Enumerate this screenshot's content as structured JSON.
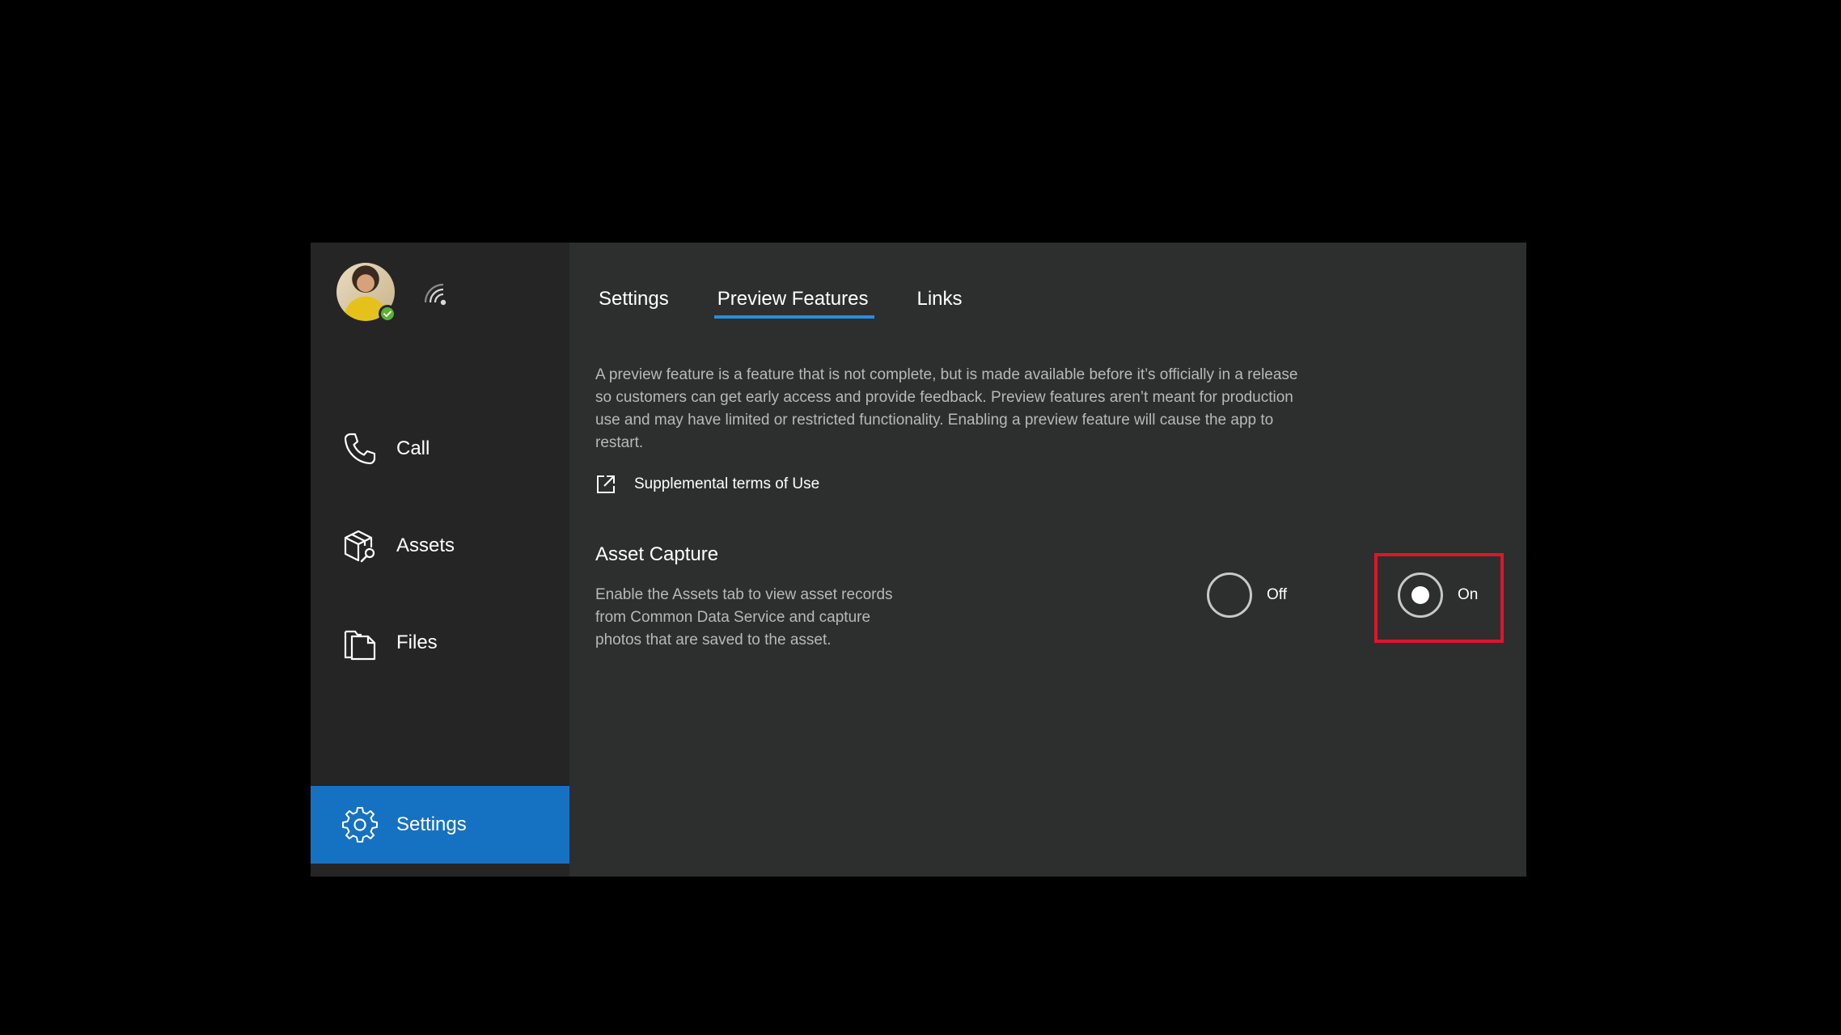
{
  "sidebar": {
    "avatar_icon": "user-avatar",
    "status_icon": "presence-available-icon",
    "signal_icon": "connection-signal-icon",
    "items": [
      {
        "label": "Call",
        "icon": "phone-icon"
      },
      {
        "label": "Assets",
        "icon": "assets-icon"
      },
      {
        "label": "Files",
        "icon": "files-icon"
      }
    ],
    "settings": {
      "label": "Settings",
      "icon": "gear-icon",
      "active": true
    }
  },
  "tabs": [
    {
      "label": "Settings"
    },
    {
      "label": "Preview Features",
      "active": true
    },
    {
      "label": "Links"
    }
  ],
  "preview": {
    "description": "A preview feature is a feature that is not complete, but is made available before it’s officially in a release so customers can get early access and provide feedback. Preview features aren’t meant for production use and may have limited or restricted functionality. Enabling a preview feature will cause the app to restart.",
    "terms_link": "Supplemental terms of Use"
  },
  "asset_capture": {
    "title": "Asset Capture",
    "description": "Enable the Assets tab to view asset records from Common Data Service and capture photos that are saved to the asset.",
    "options": [
      {
        "label": "Off",
        "selected": false
      },
      {
        "label": "On",
        "selected": true
      }
    ]
  },
  "colors": {
    "accent": "#1572c3",
    "tab_underline": "#2c8be0",
    "highlight": "#e0142b",
    "panel_bg": "#2d2e2e",
    "sidebar_bg": "#252525"
  }
}
